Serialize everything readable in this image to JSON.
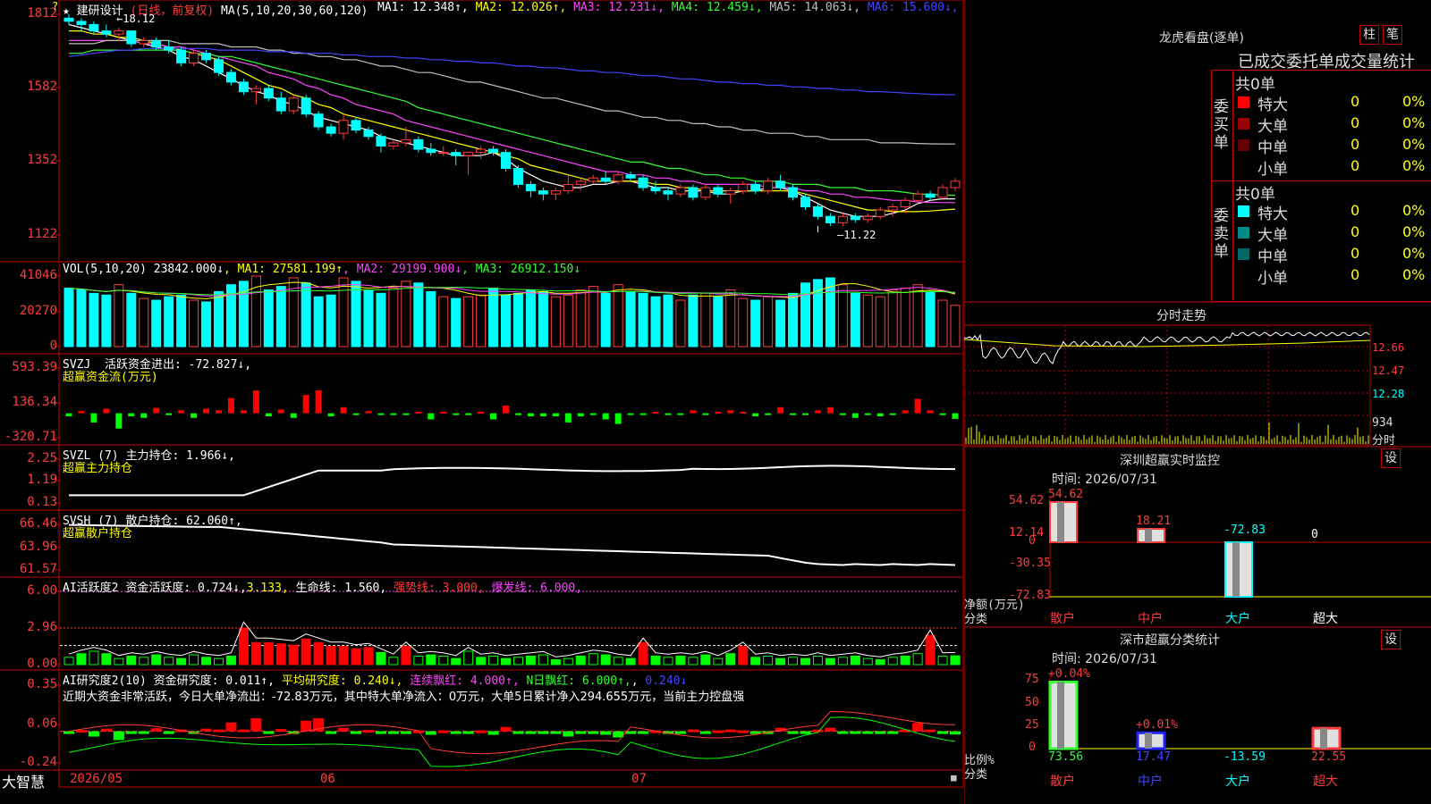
{
  "stock": {
    "name": "建研设计",
    "period": "日线，前复权",
    "star": "★"
  },
  "price_panel": {
    "indicator_text": "MA(5,10,20,30,60,120)",
    "ma": [
      {
        "label": "MA1:",
        "value": "12.348↑",
        "color": "#ffffff"
      },
      {
        "label": "MA2:",
        "value": "12.026↑",
        "color": "#ffff00"
      },
      {
        "label": "MA3:",
        "value": "12.231↓",
        "color": "#ff44ff"
      },
      {
        "label": "MA4:",
        "value": "12.459↓",
        "color": "#33ff33"
      },
      {
        "label": "MA5:",
        "value": "14.063↓",
        "color": "#c0c0c0"
      },
      {
        "label": "MA6:",
        "value": "15.600↓",
        "color": "#4444ff"
      }
    ],
    "yticks": [
      "1812",
      "1582",
      "1352",
      "1122"
    ],
    "high_label": "18.12",
    "low_label": "11.22"
  },
  "vol_panel": {
    "title": "VOL(5,10,20)",
    "value": "23842.000↓",
    "ma": [
      {
        "label": "MA1:",
        "value": "27581.199↑",
        "color": "#ffff00"
      },
      {
        "label": "MA2:",
        "value": "29199.900↓",
        "color": "#ff44ff"
      },
      {
        "label": "MA3:",
        "value": "26912.150↓",
        "color": "#33ff33"
      }
    ],
    "yticks": [
      "41046",
      "20270",
      "0"
    ]
  },
  "svzj_panel": {
    "title": "SVZJ",
    "label": "活跃资金进出:",
    "value": "-72.827↓,",
    "subtitle": "超赢资金流(万元)",
    "yticks": [
      "593.39",
      "136.34",
      "-320.71"
    ]
  },
  "svzl_panel": {
    "title": "SVZL (7)",
    "label": "主力持仓:",
    "value": "1.966↓,",
    "subtitle": "超赢主力持仓",
    "yticks": [
      "2.25",
      "1.19",
      "0.13"
    ]
  },
  "svsh_panel": {
    "title": "SVSH (7)",
    "label": "散户持仓:",
    "value": "62.060↑,",
    "subtitle": "超赢散户持仓",
    "yticks": [
      "66.46",
      "63.96",
      "61.57"
    ]
  },
  "ai_active_panel": {
    "title": "AI活跃度2",
    "label1": "资金活跃度:",
    "value1": "0.724↓,",
    "value2": "3.133,",
    "label3": "生命线:",
    "value3": "1.560,",
    "label4": "强势线:",
    "value4": "3.000,",
    "label5": "爆发线:",
    "value5": "6.000,",
    "yticks": [
      "6.00",
      "2.96",
      "0.00"
    ]
  },
  "ai_research_panel": {
    "title": "AI研究度2(10)",
    "label1": "资金研究度:",
    "value1": "0.011↑,",
    "label2": "平均研究度:",
    "value2": "0.240↓,",
    "label3": "连续飘红:",
    "value3": "4.000↑,",
    "label4": "N日飘红:",
    "value4": "6.000↑,",
    "value5": "0.240↓",
    "note": "近期大资金非常活跃，今日大单净流出：-72.83万元，其中特大单净流入：0万元，大单5日累计净入294.655万元，当前主力控盘强",
    "yticks": [
      "0.35",
      "0.06",
      "-0.24"
    ]
  },
  "x_axis": {
    "labels": [
      "2026/05",
      "06",
      "07"
    ]
  },
  "brand": "大智慧",
  "lhb": {
    "title": "龙虎看盘(逐单)",
    "btn_zhu": "柱",
    "btn_bi": "笔",
    "tabs": "已成交委托单成交量统计",
    "buy_header": "共0单",
    "buy_side": "委买单",
    "sell_header": "共0单",
    "sell_side": "委卖单",
    "buy_rows": [
      {
        "name": "特大",
        "count": "0",
        "pct": "0%",
        "color": "#ff0000"
      },
      {
        "name": "大单",
        "count": "0",
        "pct": "0%",
        "color": "#990000"
      },
      {
        "name": "中单",
        "count": "0",
        "pct": "0%",
        "color": "#660000"
      },
      {
        "name": "小单",
        "count": "0",
        "pct": "0%",
        "color": "#000000"
      }
    ],
    "sell_rows": [
      {
        "name": "特大",
        "count": "0",
        "pct": "0%",
        "color": "#00ffff"
      },
      {
        "name": "大单",
        "count": "0",
        "pct": "0%",
        "color": "#008888"
      },
      {
        "name": "中单",
        "count": "0",
        "pct": "0%",
        "color": "#006666"
      },
      {
        "name": "小单",
        "count": "0",
        "pct": "0%",
        "color": "#000000"
      }
    ]
  },
  "intraday": {
    "title": "分时走势",
    "yticks": [
      "12.66",
      "12.47",
      "12.28"
    ],
    "vol_tick": "934",
    "vol_label": "分时"
  },
  "sz_monitor": {
    "title": "深圳超赢实时监控",
    "btn": "设",
    "time": "时间: 2026/07/31",
    "yticks": [
      "54.62",
      "12.14",
      "0",
      "-30.35",
      "-72.83"
    ],
    "ylabel1": "净额(万元)",
    "ylabel2": "分类",
    "bars": [
      {
        "name": "散户",
        "value": 54.62,
        "label": "54.62"
      },
      {
        "name": "中户",
        "value": 18.21,
        "label": "18.21"
      },
      {
        "name": "大户",
        "value": -72.83,
        "label": "-72.83"
      },
      {
        "name": "超大",
        "value": 0,
        "label": "0"
      }
    ]
  },
  "sz_category": {
    "title": "深市超赢分类统计",
    "btn": "设",
    "time": "时间: 2026/07/31",
    "yticks": [
      "75",
      "50",
      "25",
      "0"
    ],
    "ylabel1": "比例%",
    "ylabel2": "分类",
    "bars": [
      {
        "name": "散户",
        "value": 73.56,
        "top_label": "+0.04%",
        "label": "73.56"
      },
      {
        "name": "中户",
        "value": 17.47,
        "top_label": "+0.01%",
        "label": "17.47"
      },
      {
        "name": "大户",
        "value": -13.59,
        "top_label": "",
        "label": "-13.59"
      },
      {
        "name": "超大",
        "value": 22.55,
        "top_label": "",
        "label": "22.55"
      }
    ]
  },
  "chart_data": {
    "type": "candlestick",
    "ylim": [
      11.22,
      18.12
    ],
    "ohlc": [
      [
        18.0,
        18.12,
        17.8,
        17.9
      ],
      [
        17.9,
        18.0,
        17.6,
        17.8
      ],
      [
        17.8,
        17.9,
        17.5,
        17.6
      ],
      [
        17.6,
        17.8,
        17.4,
        17.5
      ],
      [
        17.5,
        17.7,
        17.3,
        17.6
      ],
      [
        17.6,
        17.6,
        17.1,
        17.2
      ],
      [
        17.2,
        17.4,
        17.1,
        17.3
      ],
      [
        17.3,
        17.4,
        17.0,
        17.1
      ],
      [
        17.1,
        17.3,
        16.9,
        17.0
      ],
      [
        17.0,
        17.1,
        16.5,
        16.6
      ],
      [
        16.6,
        17.0,
        16.5,
        16.9
      ],
      [
        16.9,
        17.0,
        16.6,
        16.7
      ],
      [
        16.7,
        16.8,
        16.2,
        16.3
      ],
      [
        16.3,
        16.4,
        15.9,
        16.0
      ],
      [
        16.0,
        16.1,
        15.6,
        15.7
      ],
      [
        15.7,
        15.9,
        15.3,
        15.8
      ],
      [
        15.8,
        15.9,
        15.4,
        15.5
      ],
      [
        15.5,
        15.7,
        15.0,
        15.1
      ],
      [
        15.1,
        15.6,
        15.0,
        15.5
      ],
      [
        15.5,
        15.6,
        14.9,
        15.0
      ],
      [
        15.0,
        15.1,
        14.5,
        14.6
      ],
      [
        14.6,
        14.7,
        14.3,
        14.4
      ],
      [
        14.4,
        15.0,
        14.2,
        14.8
      ],
      [
        14.8,
        14.9,
        14.4,
        14.5
      ],
      [
        14.5,
        14.6,
        14.2,
        14.3
      ],
      [
        14.3,
        14.4,
        13.8,
        14.0
      ],
      [
        14.0,
        14.2,
        13.9,
        14.1
      ],
      [
        14.1,
        14.6,
        14.0,
        14.2
      ],
      [
        14.2,
        14.3,
        13.8,
        13.9
      ],
      [
        13.9,
        14.1,
        13.7,
        13.8
      ],
      [
        13.8,
        14.0,
        13.7,
        13.8
      ],
      [
        13.8,
        13.9,
        13.4,
        13.7
      ],
      [
        13.7,
        13.8,
        13.1,
        13.8
      ],
      [
        13.8,
        14.0,
        13.6,
        13.9
      ],
      [
        13.9,
        14.0,
        13.7,
        13.8
      ],
      [
        13.8,
        13.9,
        13.2,
        13.3
      ],
      [
        13.3,
        13.4,
        12.7,
        12.8
      ],
      [
        12.8,
        12.9,
        12.4,
        12.6
      ],
      [
        12.6,
        12.7,
        12.3,
        12.5
      ],
      [
        12.5,
        12.7,
        12.3,
        12.6
      ],
      [
        12.6,
        13.1,
        12.5,
        12.8
      ],
      [
        12.8,
        13.0,
        12.6,
        12.9
      ],
      [
        12.9,
        13.1,
        12.8,
        13.0
      ],
      [
        13.0,
        13.2,
        12.8,
        12.9
      ],
      [
        12.9,
        13.2,
        12.8,
        13.1
      ],
      [
        13.1,
        13.2,
        12.9,
        13.0
      ],
      [
        13.0,
        13.1,
        12.6,
        12.7
      ],
      [
        12.7,
        12.9,
        12.5,
        12.6
      ],
      [
        12.6,
        12.7,
        12.3,
        12.5
      ],
      [
        12.5,
        12.8,
        12.4,
        12.7
      ],
      [
        12.7,
        12.8,
        12.3,
        12.4
      ],
      [
        12.4,
        12.8,
        12.3,
        12.7
      ],
      [
        12.7,
        12.8,
        12.4,
        12.5
      ],
      [
        12.5,
        12.7,
        12.2,
        12.6
      ],
      [
        12.6,
        12.9,
        12.5,
        12.8
      ],
      [
        12.8,
        12.9,
        12.5,
        12.6
      ],
      [
        12.6,
        13.0,
        12.5,
        12.9
      ],
      [
        12.9,
        13.1,
        12.6,
        12.7
      ],
      [
        12.7,
        12.8,
        12.3,
        12.4
      ],
      [
        12.4,
        12.5,
        12.0,
        12.1
      ],
      [
        12.1,
        12.2,
        11.7,
        11.8
      ],
      [
        11.8,
        11.9,
        11.5,
        11.6
      ],
      [
        11.6,
        11.9,
        11.5,
        11.8
      ],
      [
        11.8,
        11.9,
        11.6,
        11.7
      ],
      [
        11.7,
        11.9,
        11.6,
        11.8
      ],
      [
        11.8,
        12.1,
        11.7,
        12.0
      ],
      [
        12.0,
        12.2,
        11.8,
        12.1
      ],
      [
        12.1,
        12.4,
        11.9,
        12.3
      ],
      [
        12.3,
        12.6,
        12.2,
        12.5
      ],
      [
        12.5,
        12.6,
        12.3,
        12.4
      ],
      [
        12.4,
        12.8,
        12.3,
        12.7
      ],
      [
        12.7,
        13.0,
        12.6,
        12.9
      ]
    ],
    "volume": [
      34000,
      33000,
      31000,
      30000,
      36000,
      31000,
      28000,
      27000,
      29000,
      30000,
      27000,
      26000,
      32000,
      36000,
      38000,
      41046,
      33000,
      35000,
      40000,
      37000,
      29000,
      30000,
      40000,
      38000,
      33000,
      31000,
      34000,
      38000,
      37000,
      32000,
      29000,
      28000,
      29000,
      30000,
      34000,
      30000,
      31000,
      33000,
      32000,
      29000,
      30000,
      33000,
      35000,
      31000,
      36000,
      32000,
      31000,
      29000,
      30000,
      27000,
      30000,
      31000,
      29000,
      33000,
      28000,
      27000,
      29000,
      27000,
      31000,
      37000,
      39000,
      40000,
      36000,
      31000,
      30000,
      29000,
      33000,
      34000,
      36000,
      32000,
      27000,
      24000
    ],
    "ma_price": {
      "MA1": [
        17.8,
        17.7,
        17.6,
        17.5,
        17.4,
        17.3,
        17.2,
        17.1,
        17.0,
        16.8,
        16.7,
        16.5,
        16.3,
        16.1,
        15.9,
        15.7,
        15.6,
        15.4,
        15.3,
        15.1,
        14.9,
        14.8,
        14.7,
        14.6,
        14.5,
        14.3,
        14.2,
        14.1,
        14.0,
        13.9,
        13.8,
        13.7,
        13.7,
        13.7,
        13.8,
        13.6,
        13.3,
        13.1,
        12.9,
        12.8,
        12.7,
        12.7,
        12.8,
        12.8,
        12.9,
        12.9,
        12.8,
        12.7,
        12.7,
        12.6,
        12.6,
        12.6,
        12.5,
        12.5,
        12.6,
        12.6,
        12.7,
        12.7,
        12.6,
        12.4,
        12.2,
        12.0,
        11.9,
        11.8,
        11.8,
        11.8,
        11.9,
        12.0,
        12.2,
        12.3,
        12.35,
        12.348
      ],
      "MA2": [
        17.6,
        17.6,
        17.5,
        17.5,
        17.4,
        17.4,
        17.3,
        17.2,
        17.1,
        17.0,
        16.9,
        16.8,
        16.7,
        16.5,
        16.3,
        16.1,
        15.9,
        15.8,
        15.6,
        15.5,
        15.3,
        15.2,
        15.0,
        14.9,
        14.8,
        14.7,
        14.6,
        14.5,
        14.4,
        14.3,
        14.2,
        14.1,
        14.0,
        13.9,
        13.8,
        13.7,
        13.6,
        13.4,
        13.3,
        13.2,
        13.1,
        13.0,
        12.9,
        12.9,
        12.9,
        12.9,
        12.9,
        12.8,
        12.8,
        12.7,
        12.7,
        12.6,
        12.6,
        12.6,
        12.6,
        12.6,
        12.6,
        12.6,
        12.6,
        12.5,
        12.4,
        12.3,
        12.2,
        12.1,
        12.0,
        12.0,
        11.95,
        11.95,
        11.95,
        11.97,
        12.0,
        12.026
      ],
      "MA3": [
        17.3,
        17.3,
        17.3,
        17.3,
        17.3,
        17.3,
        17.2,
        17.2,
        17.1,
        17.1,
        17.0,
        16.9,
        16.8,
        16.7,
        16.6,
        16.5,
        16.3,
        16.2,
        16.1,
        15.9,
        15.8,
        15.6,
        15.5,
        15.3,
        15.2,
        15.1,
        15.0,
        14.8,
        14.7,
        14.6,
        14.5,
        14.4,
        14.3,
        14.2,
        14.1,
        14.0,
        13.9,
        13.8,
        13.7,
        13.6,
        13.5,
        13.4,
        13.3,
        13.2,
        13.2,
        13.1,
        13.1,
        13.0,
        13.0,
        12.9,
        12.9,
        12.8,
        12.8,
        12.8,
        12.8,
        12.8,
        12.7,
        12.7,
        12.7,
        12.6,
        12.6,
        12.5,
        12.5,
        12.4,
        12.4,
        12.35,
        12.3,
        12.3,
        12.25,
        12.24,
        12.23,
        12.231
      ],
      "MA4": [
        16.9,
        16.9,
        17.0,
        17.0,
        17.0,
        17.0,
        17.0,
        17.0,
        17.0,
        17.0,
        16.9,
        16.9,
        16.8,
        16.8,
        16.7,
        16.6,
        16.5,
        16.4,
        16.3,
        16.2,
        16.1,
        16.0,
        15.9,
        15.8,
        15.7,
        15.6,
        15.5,
        15.4,
        15.2,
        15.1,
        15.0,
        14.9,
        14.8,
        14.7,
        14.6,
        14.5,
        14.4,
        14.3,
        14.2,
        14.1,
        14.0,
        13.9,
        13.8,
        13.7,
        13.6,
        13.5,
        13.5,
        13.4,
        13.3,
        13.3,
        13.2,
        13.1,
        13.1,
        13.0,
        13.0,
        12.9,
        12.9,
        12.9,
        12.8,
        12.8,
        12.8,
        12.7,
        12.7,
        12.7,
        12.6,
        12.6,
        12.6,
        12.55,
        12.5,
        12.49,
        12.47,
        12.459
      ],
      "MA5": [
        17.2,
        17.2,
        17.2,
        17.3,
        17.3,
        17.3,
        17.3,
        17.3,
        17.3,
        17.2,
        17.2,
        17.2,
        17.2,
        17.1,
        17.1,
        17.1,
        17.0,
        17.0,
        16.9,
        16.9,
        16.8,
        16.8,
        16.7,
        16.7,
        16.6,
        16.5,
        16.5,
        16.4,
        16.3,
        16.3,
        16.2,
        16.1,
        16.0,
        16.0,
        15.9,
        15.8,
        15.7,
        15.6,
        15.5,
        15.5,
        15.4,
        15.3,
        15.2,
        15.1,
        15.1,
        15.0,
        14.9,
        14.9,
        14.8,
        14.8,
        14.7,
        14.7,
        14.6,
        14.6,
        14.5,
        14.5,
        14.4,
        14.4,
        14.4,
        14.3,
        14.3,
        14.2,
        14.2,
        14.2,
        14.2,
        14.1,
        14.1,
        14.1,
        14.08,
        14.07,
        14.066,
        14.063
      ],
      "MA6": [
        16.8,
        16.85,
        16.9,
        16.95,
        17.0,
        17.0,
        17.05,
        17.05,
        17.05,
        17.05,
        17.05,
        17.05,
        17.0,
        17.0,
        17.0,
        17.0,
        16.95,
        16.95,
        16.95,
        16.9,
        16.9,
        16.9,
        16.85,
        16.85,
        16.8,
        16.8,
        16.8,
        16.75,
        16.75,
        16.7,
        16.7,
        16.65,
        16.65,
        16.6,
        16.6,
        16.55,
        16.5,
        16.5,
        16.45,
        16.45,
        16.4,
        16.35,
        16.35,
        16.3,
        16.3,
        16.25,
        16.2,
        16.2,
        16.15,
        16.1,
        16.1,
        16.05,
        16.0,
        16.0,
        15.95,
        15.95,
        15.9,
        15.9,
        15.85,
        15.85,
        15.8,
        15.8,
        15.75,
        15.75,
        15.7,
        15.7,
        15.68,
        15.66,
        15.64,
        15.62,
        15.61,
        15.6
      ]
    },
    "svzj": [
      -40,
      30,
      -120,
      60,
      -200,
      -40,
      -60,
      70,
      -20,
      40,
      -60,
      60,
      40,
      200,
      40,
      300,
      -40,
      50,
      -60,
      240,
      300,
      -40,
      80,
      -20,
      30,
      -20,
      -20,
      -20,
      20,
      -80,
      20,
      -20,
      -20,
      20,
      -80,
      100,
      -20,
      -40,
      -40,
      -40,
      -120,
      -40,
      -20,
      -80,
      -140,
      -20,
      -20,
      20,
      -20,
      -20,
      40,
      -20,
      20,
      40,
      20,
      -40,
      -20,
      80,
      -20,
      -20,
      40,
      80,
      -20,
      -60,
      -20,
      -40,
      -20,
      40,
      190,
      40,
      -20,
      -73
    ],
    "ai_active": [
      0.6,
      0.9,
      1.1,
      0.9,
      0.5,
      0.7,
      0.6,
      0.8,
      0.6,
      0.5,
      0.8,
      0.6,
      0.5,
      0.7,
      3.0,
      1.8,
      1.8,
      1.7,
      1.6,
      2.1,
      1.8,
      1.5,
      1.5,
      1.3,
      1.4,
      1.0,
      0.6,
      1.5,
      0.7,
      0.8,
      0.7,
      0.5,
      1.1,
      0.6,
      0.7,
      0.5,
      0.6,
      0.7,
      0.8,
      0.4,
      0.5,
      0.7,
      0.9,
      0.8,
      0.6,
      0.5,
      1.8,
      0.7,
      0.6,
      0.7,
      0.6,
      0.8,
      0.5,
      0.9,
      1.5,
      0.6,
      0.7,
      0.5,
      0.6,
      0.5,
      0.7,
      0.5,
      0.6,
      0.7,
      0.5,
      0.4,
      0.6,
      0.7,
      0.9,
      2.4,
      0.7,
      0.724
    ]
  }
}
